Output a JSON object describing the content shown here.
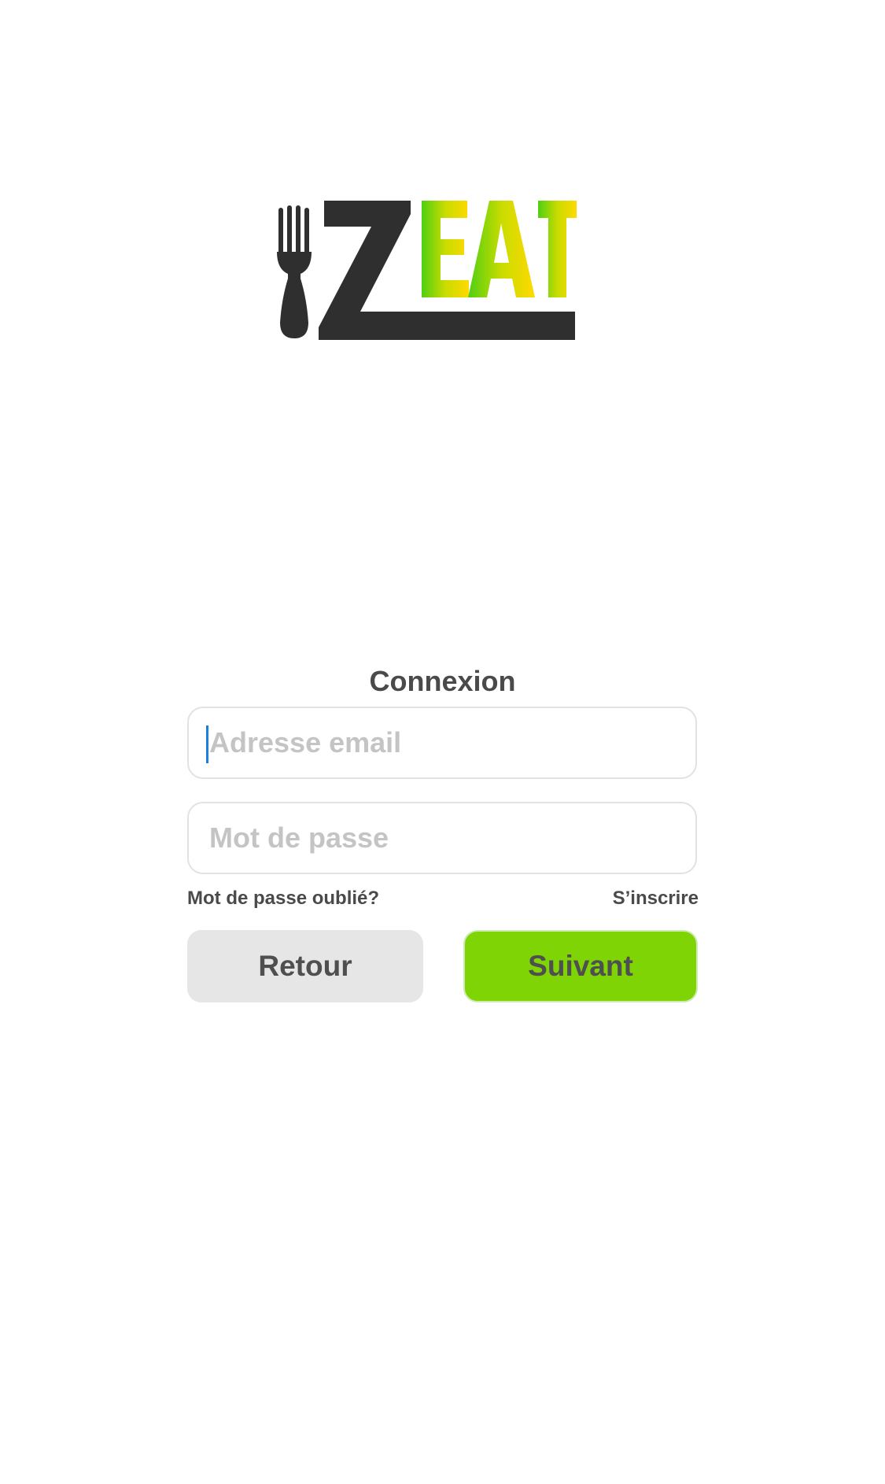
{
  "logo": {
    "text": "ZEAT",
    "accent_colors": [
      "#5fd10f",
      "#c7dd00",
      "#ffda00"
    ],
    "dark_color": "#2f2f2f",
    "icon": "fork-icon"
  },
  "login": {
    "title": "Connexion",
    "email_placeholder": "Adresse email",
    "email_value": "",
    "password_placeholder": "Mot de passe",
    "password_value": "",
    "forgot_password_label": "Mot de passe oublié?",
    "signup_label": "S’inscrire",
    "back_label": "Retour",
    "next_label": "Suivant"
  },
  "colors": {
    "primary": "#7fd406",
    "secondary": "#e6e6e6",
    "text": "#4a4a4a",
    "placeholder": "#c4c4c4",
    "caret": "#1a7fe0"
  }
}
